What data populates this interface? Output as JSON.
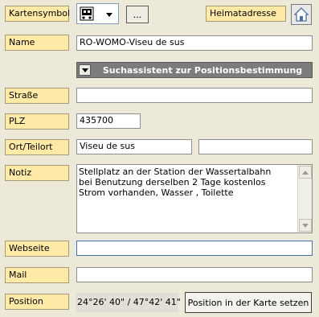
{
  "labels": {
    "kartensymbol": "Kartensymbol",
    "heimatadresse": "Heimatadresse",
    "name": "Name",
    "strasse": "Straße",
    "plz": "PLZ",
    "ort": "Ort/Teilort",
    "notiz": "Notiz",
    "webseite": "Webseite",
    "mail": "Mail",
    "position": "Position"
  },
  "kartensymbol": {
    "ellipsis_label": "...",
    "icon": "train-icon"
  },
  "heimatadresse": {
    "icon": "home-icon"
  },
  "fields": {
    "name": "RO-WOMO-Viseu de sus",
    "strasse": "",
    "plz": "435700",
    "ort": "Viseu de sus",
    "teilort": "",
    "notiz_lines": [
      "Stellplatz an der Station der Wassertalbahn",
      "bei Benutzung derselben 2 Tage kostenlos",
      "Strom vorhanden, Wasser , Toilette"
    ],
    "webseite": "",
    "mail": ""
  },
  "suchassistent": {
    "label": "Suchassistent zur Positionsbestimmung"
  },
  "position": {
    "value": "24°26' 40\" / 47°42' 41\"",
    "set_button": "Position in der Karte setzen"
  },
  "colors": {
    "background": "#ece9d8",
    "label_bg": "#ffeaa8",
    "assistant_bg": "#7c7c7c",
    "field_focus_border": "#4470b2"
  }
}
